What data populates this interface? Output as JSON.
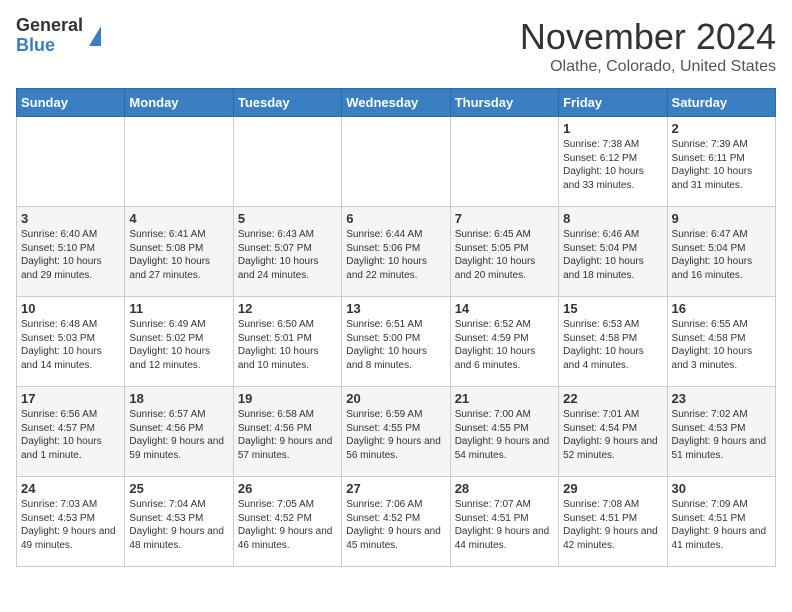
{
  "header": {
    "logo_general": "General",
    "logo_blue": "Blue",
    "title": "November 2024",
    "subtitle": "Olathe, Colorado, United States"
  },
  "weekdays": [
    "Sunday",
    "Monday",
    "Tuesday",
    "Wednesday",
    "Thursday",
    "Friday",
    "Saturday"
  ],
  "weeks": [
    [
      {
        "day": "",
        "info": ""
      },
      {
        "day": "",
        "info": ""
      },
      {
        "day": "",
        "info": ""
      },
      {
        "day": "",
        "info": ""
      },
      {
        "day": "",
        "info": ""
      },
      {
        "day": "1",
        "info": "Sunrise: 7:38 AM\nSunset: 6:12 PM\nDaylight: 10 hours and 33 minutes."
      },
      {
        "day": "2",
        "info": "Sunrise: 7:39 AM\nSunset: 6:11 PM\nDaylight: 10 hours and 31 minutes."
      }
    ],
    [
      {
        "day": "3",
        "info": "Sunrise: 6:40 AM\nSunset: 5:10 PM\nDaylight: 10 hours and 29 minutes."
      },
      {
        "day": "4",
        "info": "Sunrise: 6:41 AM\nSunset: 5:08 PM\nDaylight: 10 hours and 27 minutes."
      },
      {
        "day": "5",
        "info": "Sunrise: 6:43 AM\nSunset: 5:07 PM\nDaylight: 10 hours and 24 minutes."
      },
      {
        "day": "6",
        "info": "Sunrise: 6:44 AM\nSunset: 5:06 PM\nDaylight: 10 hours and 22 minutes."
      },
      {
        "day": "7",
        "info": "Sunrise: 6:45 AM\nSunset: 5:05 PM\nDaylight: 10 hours and 20 minutes."
      },
      {
        "day": "8",
        "info": "Sunrise: 6:46 AM\nSunset: 5:04 PM\nDaylight: 10 hours and 18 minutes."
      },
      {
        "day": "9",
        "info": "Sunrise: 6:47 AM\nSunset: 5:04 PM\nDaylight: 10 hours and 16 minutes."
      }
    ],
    [
      {
        "day": "10",
        "info": "Sunrise: 6:48 AM\nSunset: 5:03 PM\nDaylight: 10 hours and 14 minutes."
      },
      {
        "day": "11",
        "info": "Sunrise: 6:49 AM\nSunset: 5:02 PM\nDaylight: 10 hours and 12 minutes."
      },
      {
        "day": "12",
        "info": "Sunrise: 6:50 AM\nSunset: 5:01 PM\nDaylight: 10 hours and 10 minutes."
      },
      {
        "day": "13",
        "info": "Sunrise: 6:51 AM\nSunset: 5:00 PM\nDaylight: 10 hours and 8 minutes."
      },
      {
        "day": "14",
        "info": "Sunrise: 6:52 AM\nSunset: 4:59 PM\nDaylight: 10 hours and 6 minutes."
      },
      {
        "day": "15",
        "info": "Sunrise: 6:53 AM\nSunset: 4:58 PM\nDaylight: 10 hours and 4 minutes."
      },
      {
        "day": "16",
        "info": "Sunrise: 6:55 AM\nSunset: 4:58 PM\nDaylight: 10 hours and 3 minutes."
      }
    ],
    [
      {
        "day": "17",
        "info": "Sunrise: 6:56 AM\nSunset: 4:57 PM\nDaylight: 10 hours and 1 minute."
      },
      {
        "day": "18",
        "info": "Sunrise: 6:57 AM\nSunset: 4:56 PM\nDaylight: 9 hours and 59 minutes."
      },
      {
        "day": "19",
        "info": "Sunrise: 6:58 AM\nSunset: 4:56 PM\nDaylight: 9 hours and 57 minutes."
      },
      {
        "day": "20",
        "info": "Sunrise: 6:59 AM\nSunset: 4:55 PM\nDaylight: 9 hours and 56 minutes."
      },
      {
        "day": "21",
        "info": "Sunrise: 7:00 AM\nSunset: 4:55 PM\nDaylight: 9 hours and 54 minutes."
      },
      {
        "day": "22",
        "info": "Sunrise: 7:01 AM\nSunset: 4:54 PM\nDaylight: 9 hours and 52 minutes."
      },
      {
        "day": "23",
        "info": "Sunrise: 7:02 AM\nSunset: 4:53 PM\nDaylight: 9 hours and 51 minutes."
      }
    ],
    [
      {
        "day": "24",
        "info": "Sunrise: 7:03 AM\nSunset: 4:53 PM\nDaylight: 9 hours and 49 minutes."
      },
      {
        "day": "25",
        "info": "Sunrise: 7:04 AM\nSunset: 4:53 PM\nDaylight: 9 hours and 48 minutes."
      },
      {
        "day": "26",
        "info": "Sunrise: 7:05 AM\nSunset: 4:52 PM\nDaylight: 9 hours and 46 minutes."
      },
      {
        "day": "27",
        "info": "Sunrise: 7:06 AM\nSunset: 4:52 PM\nDaylight: 9 hours and 45 minutes."
      },
      {
        "day": "28",
        "info": "Sunrise: 7:07 AM\nSunset: 4:51 PM\nDaylight: 9 hours and 44 minutes."
      },
      {
        "day": "29",
        "info": "Sunrise: 7:08 AM\nSunset: 4:51 PM\nDaylight: 9 hours and 42 minutes."
      },
      {
        "day": "30",
        "info": "Sunrise: 7:09 AM\nSunset: 4:51 PM\nDaylight: 9 hours and 41 minutes."
      }
    ]
  ]
}
